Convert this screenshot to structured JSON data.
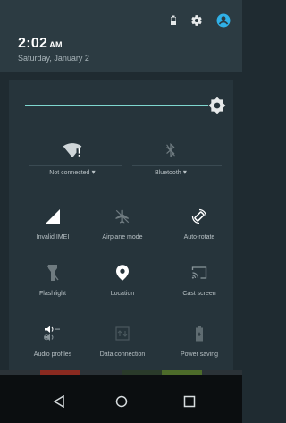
{
  "status": {
    "icons": [
      "battery-icon",
      "settings-icon",
      "account-icon"
    ]
  },
  "header": {
    "time": "2:02",
    "ampm": "AM",
    "date": "Saturday, January 2"
  },
  "brightness": {
    "level": 1.0
  },
  "tiles": {
    "row1": [
      {
        "label": "Not connected",
        "icon": "wifi-icon"
      },
      {
        "label": "Bluetooth",
        "icon": "bluetooth-icon"
      }
    ],
    "row2": [
      {
        "label": "Invalid IMEI",
        "icon": "signal-icon"
      },
      {
        "label": "Airplane mode",
        "icon": "airplane-icon"
      },
      {
        "label": "Auto-rotate",
        "icon": "rotate-icon"
      }
    ],
    "row3": [
      {
        "label": "Flashlight",
        "icon": "flashlight-icon"
      },
      {
        "label": "Location",
        "icon": "location-icon"
      },
      {
        "label": "Cast screen",
        "icon": "cast-icon"
      }
    ],
    "row4": [
      {
        "label": "Audio profiles",
        "icon": "audio-profiles-icon"
      },
      {
        "label": "Data connection",
        "icon": "data-connection-icon"
      },
      {
        "label": "Power saving",
        "icon": "battery-saver-icon"
      }
    ]
  },
  "colors": {
    "accent": "#7fd7cf",
    "account": "#30b0e6"
  }
}
